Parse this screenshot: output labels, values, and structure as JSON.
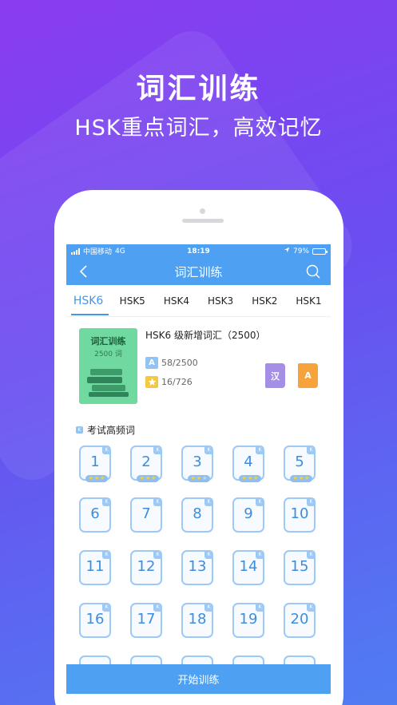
{
  "headline": "词汇训练",
  "subheadline": "HSK重点词汇，高效记忆",
  "status_bar": {
    "carrier": "中国移动",
    "network": "4G",
    "time": "18:19",
    "battery": "79%",
    "battery_level": 0.79
  },
  "nav": {
    "title": "词汇训练",
    "back_icon": "chevron-left-icon",
    "search_icon": "search-icon"
  },
  "tabs": [
    {
      "label": "HSK6",
      "active": true
    },
    {
      "label": "HSK5",
      "active": false
    },
    {
      "label": "HSK4",
      "active": false
    },
    {
      "label": "HSK3",
      "active": false
    },
    {
      "label": "HSK2",
      "active": false
    },
    {
      "label": "HSK1",
      "active": false
    }
  ],
  "book": {
    "cover_title": "词汇训练",
    "cover_count": "2500 词",
    "title": "HSK6 级新增词汇（2500）",
    "learned_icon_label": "A",
    "learned": "58/2500",
    "starred": "16/726",
    "dict_cn_label": "汉",
    "dict_en_label": "A",
    "colors": {
      "cover": "#6fd9a0",
      "learned_icon": "#8fc4f5",
      "star_icon": "#f5c842",
      "dict_cn": "#a58ee6",
      "dict_en": "#f5a33a"
    }
  },
  "section": {
    "title": "考试高频词",
    "badge": "K"
  },
  "units": [
    {
      "label": "1",
      "stars": 3
    },
    {
      "label": "2",
      "stars": 3
    },
    {
      "label": "3",
      "stars": 2
    },
    {
      "label": "4",
      "stars": 3
    },
    {
      "label": "5",
      "stars": 3
    },
    {
      "label": "6"
    },
    {
      "label": "7"
    },
    {
      "label": "8"
    },
    {
      "label": "9"
    },
    {
      "label": "10"
    },
    {
      "label": "11"
    },
    {
      "label": "12"
    },
    {
      "label": "13"
    },
    {
      "label": "14"
    },
    {
      "label": "15"
    },
    {
      "label": "16"
    },
    {
      "label": "17"
    },
    {
      "label": "18"
    },
    {
      "label": "19"
    },
    {
      "label": "20"
    }
  ],
  "unit_badge": "K",
  "start_button": "开始训练"
}
